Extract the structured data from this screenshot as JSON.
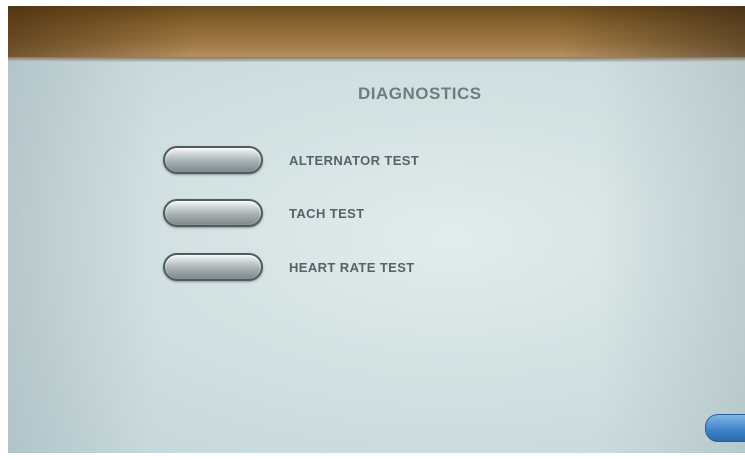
{
  "screen": {
    "title": "DIAGNOSTICS"
  },
  "tests": [
    {
      "label": "ALTERNATOR TEST"
    },
    {
      "label": "TACH TEST"
    },
    {
      "label": "HEART RATE TEST"
    }
  ],
  "colors": {
    "title_text": "#6f7d83",
    "label_text": "#546368",
    "screen_background": "#d3e1e2",
    "corner_button": "#3d82c9"
  }
}
